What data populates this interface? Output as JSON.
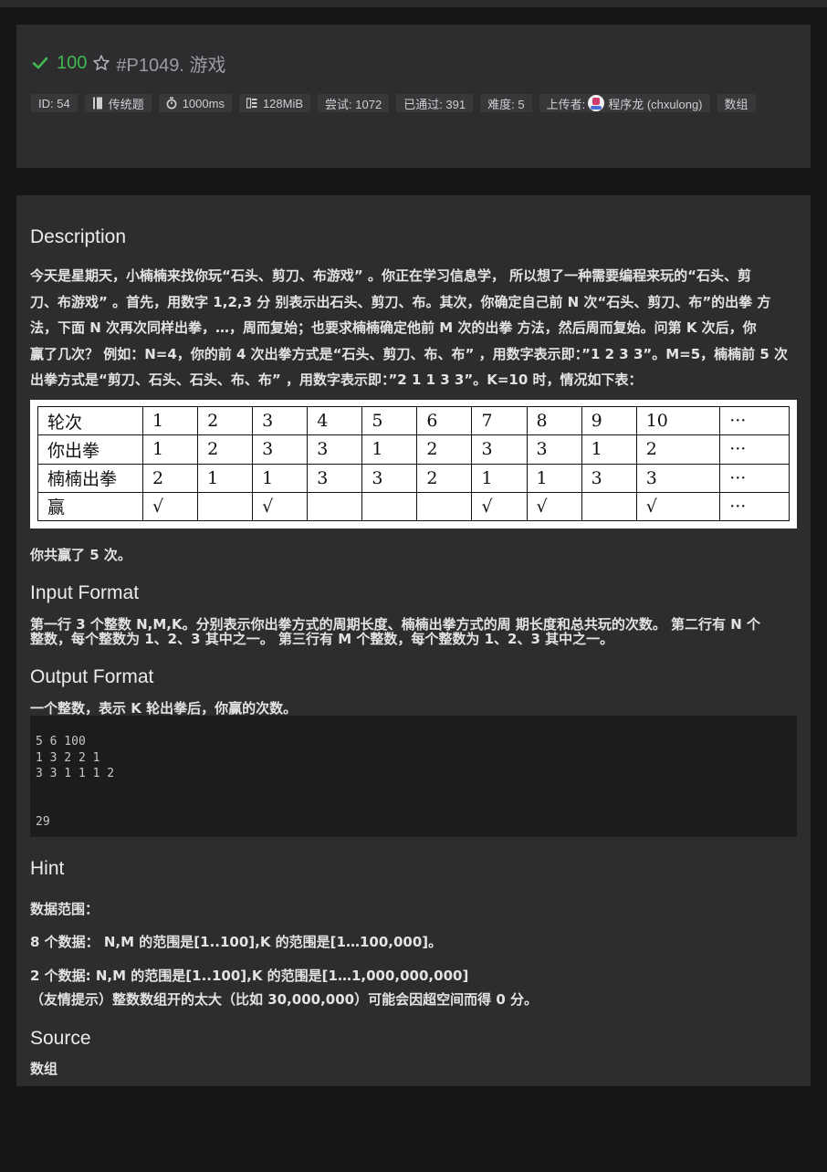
{
  "header": {
    "score": "100",
    "problem_id": "#P1049. 游戏",
    "tags": [
      {
        "label": "ID: 54"
      },
      {
        "label": "传统题",
        "icon": "file-icon"
      },
      {
        "label": "1000ms",
        "icon": "stopwatch-icon"
      },
      {
        "label": "128MiB",
        "icon": "memory-icon"
      },
      {
        "label": "尝试: 1072"
      },
      {
        "label": "已通过: 391"
      },
      {
        "label": "难度: 5"
      },
      {
        "label": "上传者:",
        "user": "程序龙 (chxulong)"
      },
      {
        "label": "数组"
      }
    ],
    "colors": {
      "accent_green": "#3fb950",
      "card_bg": "#2d2d30",
      "page_bg": "#161616"
    }
  },
  "description": {
    "heading": "Description",
    "lines": [
      "今天是星期天，小楠楠来找你玩“石头、剪刀、布游戏” 。你正在学习信息学， 所以想了一种需要编程来玩的“石头、剪",
      "刀、布游戏” 。首先，用数字 1,2,3 分 别表示出石头、剪刀、布。其次，你确定自己前 N 次“石头、剪刀、布”的出拳 方",
      "法，下面 N 次再次同样出拳，…，周而复始；也要求楠楠确定他前 M 次的出拳 方法，然后周而复始。问第 K 次后，你",
      "赢了几次？ 例如：N=4，你的前 4 次出拳方式是“石头、剪刀、布、布” ，用数字表示即：”1 2 3 3”。M=5，楠楠前 5 次",
      "出拳方式是“剪刀、石头、石头、布、布” ，用数字表示即：”2 1 1 3 3”。K=10 时，情况如下表："
    ],
    "table": [
      [
        "轮次",
        "1",
        "2",
        "3",
        "4",
        "5",
        "6",
        "7",
        "8",
        "9",
        "10",
        "···"
      ],
      [
        "你出拳",
        "1",
        "2",
        "3",
        "3",
        "1",
        "2",
        "3",
        "3",
        "1",
        "2",
        "···"
      ],
      [
        "楠楠出拳",
        "2",
        "1",
        "1",
        "3",
        "3",
        "2",
        "1",
        "1",
        "3",
        "3",
        "···"
      ],
      [
        "赢",
        "√",
        "",
        "√",
        "",
        "",
        "",
        "√",
        "√",
        "",
        "√",
        "···"
      ]
    ],
    "result": "你共赢了 5 次。"
  },
  "input_format": {
    "heading": "Input Format",
    "lines": [
      "第一行 3 个整数 N,M,K。分别表示你出拳方式的周期长度、楠楠出拳方式的周 期长度和总共玩的次数。 第二行有 N 个",
      "整数，每个整数为 1、2、3 其中之一。 第三行有 M 个整数，每个整数为 1、2、3 其中之一。"
    ]
  },
  "output_format": {
    "heading": "Output Format",
    "text": "一个整数，表示 K 轮出拳后，你赢的次数。"
  },
  "sample": {
    "lines": [
      "5 6 100",
      "1 3 2 2 1",
      "3 3 1 1 1 2",
      "",
      "",
      "29"
    ]
  },
  "hint": {
    "heading": "Hint",
    "range_label": "数据范围：",
    "line1": "8 个数据： N,M 的范围是[1..100],K 的范围是[1…100,000]。",
    "line2": "2 个数据: N,M 的范围是[1..100],K 的范围是[1…1,000,000,000]",
    "line3": "（友情提示）整数数组开的太大（比如 30,000,000）可能会因超空间而得 0 分。"
  },
  "source": {
    "heading": "Source",
    "text": "数组"
  }
}
